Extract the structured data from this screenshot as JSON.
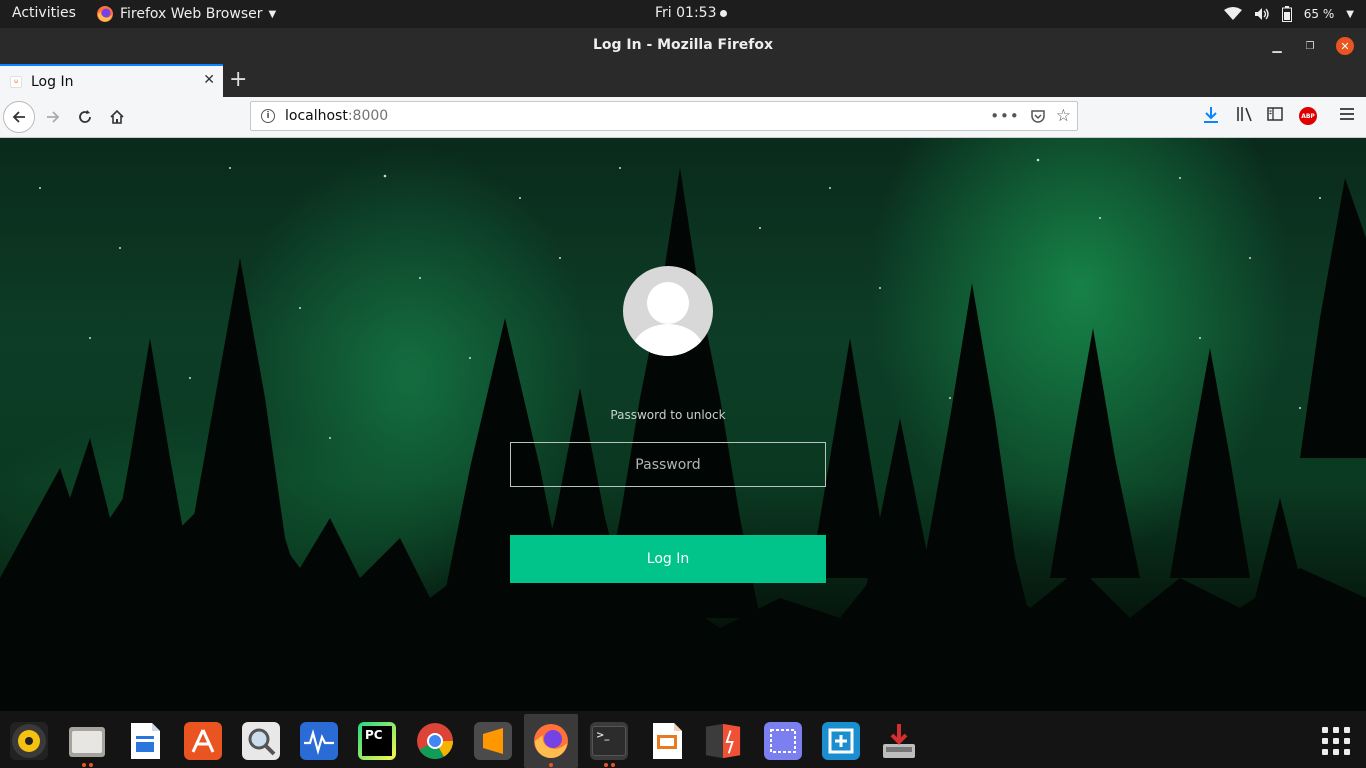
{
  "topbar": {
    "activities": "Activities",
    "app_name": "Firefox Web Browser",
    "clock": "Fri 01:53",
    "battery": "65 %"
  },
  "window": {
    "title": "Log In - Mozilla Firefox"
  },
  "tabs": [
    {
      "label": "Log In",
      "favicon": "u"
    }
  ],
  "navbar": {
    "url_host": "localhost",
    "url_port": ":8000"
  },
  "login": {
    "prompt": "Password to unlock",
    "password_placeholder": "Password",
    "button_label": "Log In"
  },
  "dock": {
    "items": [
      "rhythmbox-icon",
      "files-icon",
      "writer-icon",
      "software-icon",
      "search-icon",
      "monitor-icon",
      "pycharm-icon",
      "chrome-icon",
      "sublime-icon",
      "firefox-icon",
      "terminal-icon",
      "impress-icon",
      "git-icon",
      "screenshot-icon",
      "screen-capture-icon",
      "installer-icon"
    ]
  },
  "colors": {
    "accent": "#00c48a",
    "ubuntu_orange": "#e95420",
    "firefox_blue": "#0a84ff"
  }
}
